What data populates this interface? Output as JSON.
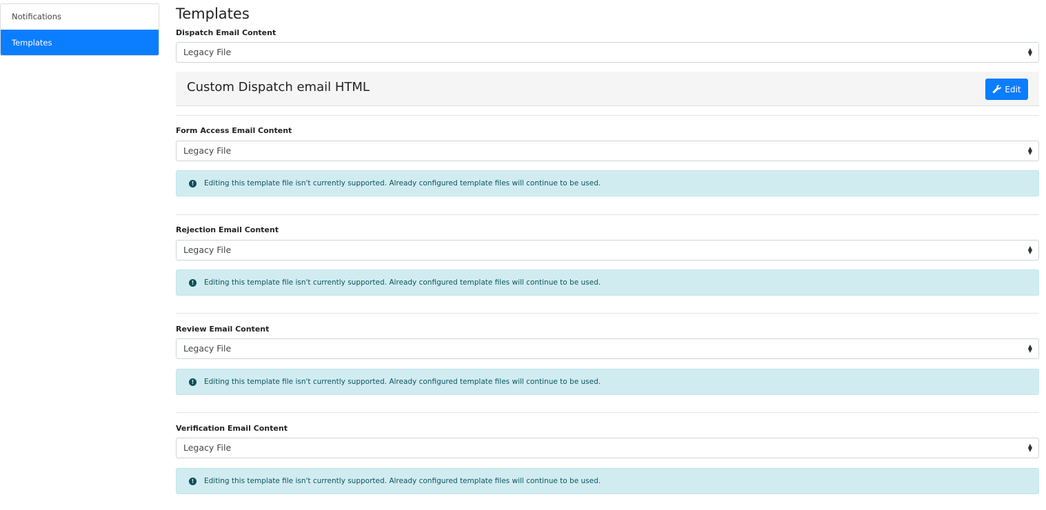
{
  "sidebar": {
    "items": [
      {
        "label": "Notifications",
        "active": false
      },
      {
        "label": "Templates",
        "active": true
      }
    ]
  },
  "main": {
    "title": "Templates",
    "dispatch": {
      "label": "Dispatch Email Content",
      "value": "Legacy File",
      "custom_title": "Custom Dispatch email HTML",
      "edit_label": "Edit"
    },
    "form_access": {
      "label": "Form Access Email Content",
      "value": "Legacy File",
      "alert": "Editing this template file isn't currently supported.  Already configured template files will continue to be used."
    },
    "rejection": {
      "label": "Rejection Email Content",
      "value": "Legacy File",
      "alert": "Editing this template file isn't currently supported.  Already configured template files will continue to be used."
    },
    "review": {
      "label": "Review Email Content",
      "value": "Legacy File",
      "alert": "Editing this template file isn't currently supported.  Already configured template files will continue to be used."
    },
    "verification": {
      "label": "Verification Email Content",
      "value": "Legacy File",
      "alert": "Editing this template file isn't currently supported.  Already configured template files will continue to be used."
    }
  },
  "colors": {
    "accent": "#0b7dff",
    "alert_bg": "#d1ecf1",
    "alert_text": "#0c5460"
  },
  "icons": {
    "edit": "wrench-icon",
    "alert": "info-icon",
    "select": "sort-arrows-icon"
  }
}
